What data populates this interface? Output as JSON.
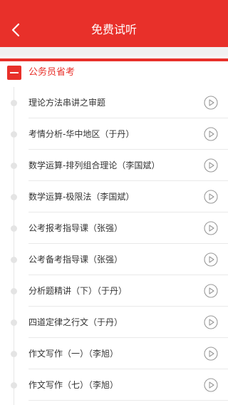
{
  "header": {
    "title": "免费试听",
    "back_icon": "chevron-left-icon",
    "bg_color": "#e8302a"
  },
  "section": {
    "title": "公务员省考",
    "toggle_icon": "minus-icon"
  },
  "lessons": [
    {
      "label": "理论方法串讲之审题"
    },
    {
      "label": "考情分析-华中地区（于丹）"
    },
    {
      "label": "数学运算-排列组合理论（李国斌）"
    },
    {
      "label": "数学运算-极限法（李国斌）"
    },
    {
      "label": "公考报考指导课（张强）"
    },
    {
      "label": "公考备考指导课（张强）"
    },
    {
      "label": "分析题精讲（下）（于丹）"
    },
    {
      "label": "四道定律之行文（于丹）"
    },
    {
      "label": "作文写作（一）（李旭）"
    },
    {
      "label": "作文写作（七）（李旭）"
    }
  ],
  "play_icon": "play-circle-icon"
}
